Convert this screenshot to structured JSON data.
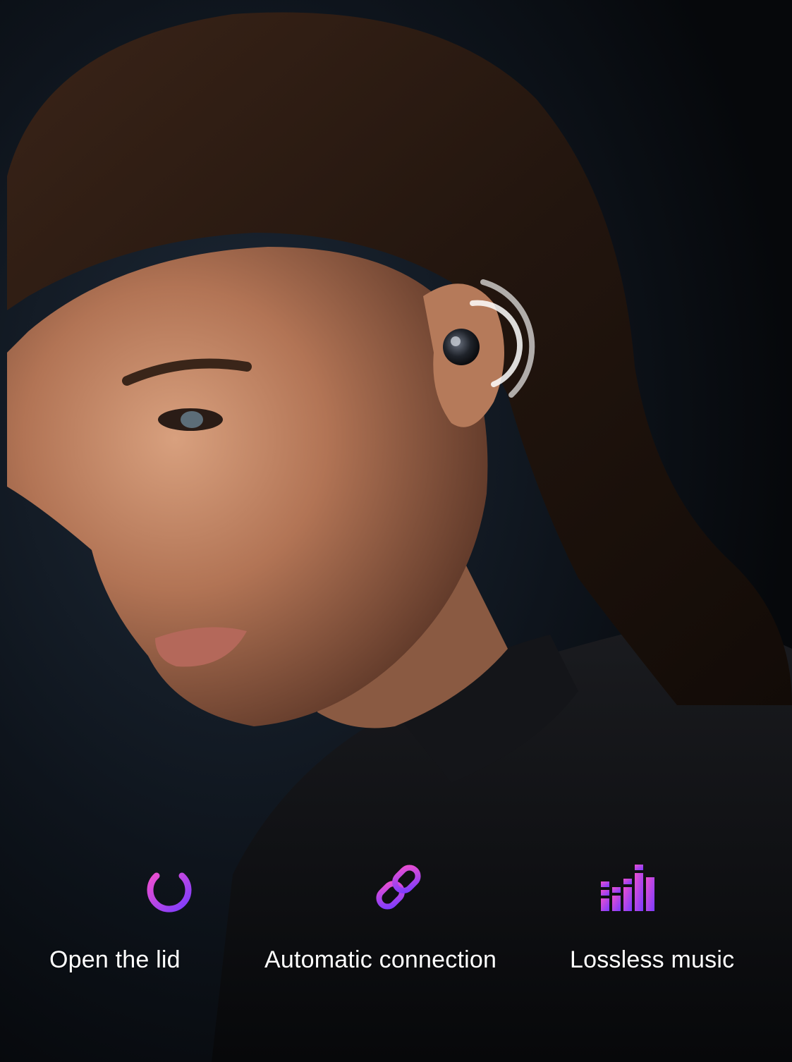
{
  "features": [
    {
      "label": "Open the lid",
      "icon": "power-icon"
    },
    {
      "label": "Automatic connection",
      "icon": "link-icon"
    },
    {
      "label": "Lossless music",
      "icon": "equalizer-icon"
    }
  ],
  "colors": {
    "icon_gradient_start": "#ec4fd0",
    "icon_gradient_end": "#7a3cff",
    "label": "#ffffff",
    "background": "#0b0e14"
  }
}
